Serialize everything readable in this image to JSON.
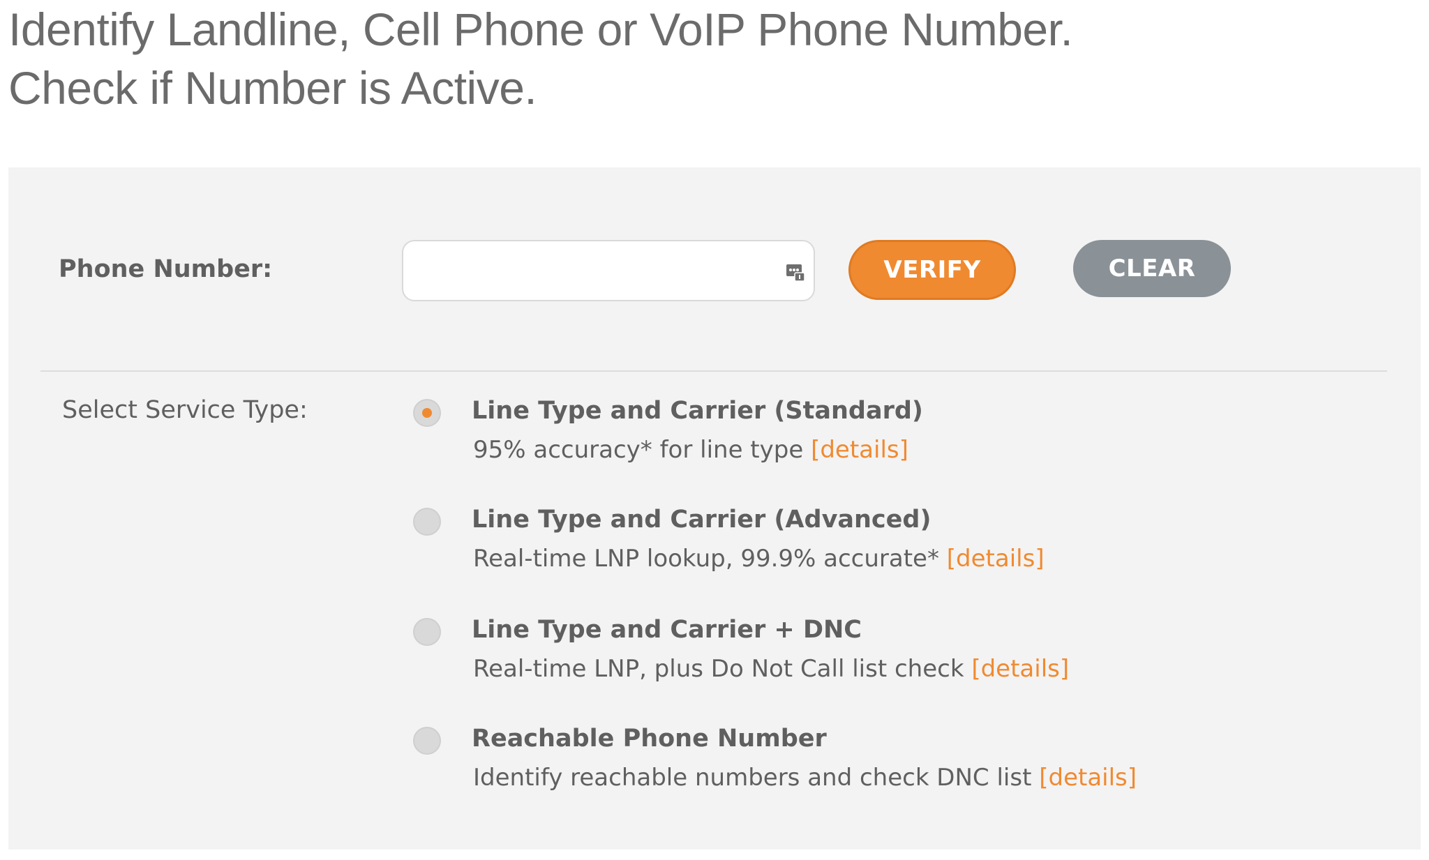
{
  "header": {
    "line1": "Identify Landline, Cell Phone or VoIP Phone Number.",
    "line2": "Check if Number is Active."
  },
  "form": {
    "phone_label": "Phone Number:",
    "phone_value": "",
    "phone_placeholder": "",
    "verify_label": "VERIFY",
    "clear_label": "CLEAR",
    "service_label": "Select Service Type:"
  },
  "options": [
    {
      "title": "Line Type and Carrier (Standard)",
      "desc": "95% accuracy* for line type",
      "link": "[details]",
      "selected": true
    },
    {
      "title": "Line Type and Carrier (Advanced)",
      "desc": "Real-time LNP lookup, 99.9% accurate*",
      "link": "[details]",
      "selected": false
    },
    {
      "title": "Line Type and Carrier + DNC",
      "desc": "Real-time LNP, plus Do Not Call list check",
      "link": "[details]",
      "selected": false
    },
    {
      "title": "Reachable Phone Number",
      "desc": "Identify reachable numbers and check DNC list",
      "link": "[details]",
      "selected": false
    }
  ],
  "colors": {
    "accent": "#f08a30",
    "clear_button": "#8a9197",
    "panel_bg": "#f3f3f3",
    "text": "#5f5f5f"
  },
  "icons": {
    "input_icon": "contact-card-icon",
    "radio_selected": "radio-checked-icon",
    "radio_unselected": "radio-unchecked-icon"
  }
}
